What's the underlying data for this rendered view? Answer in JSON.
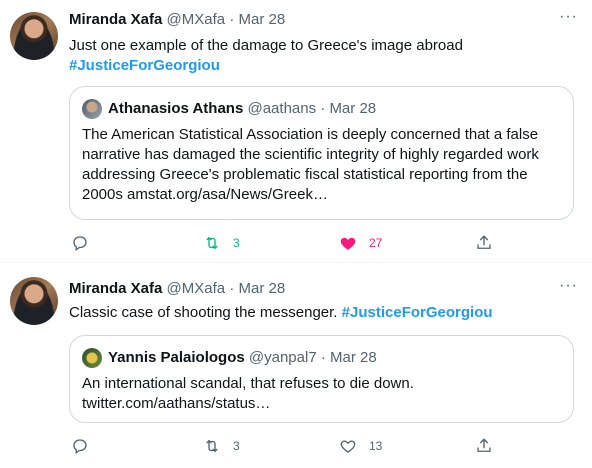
{
  "tweets": [
    {
      "author_name": "Miranda Xafa",
      "author_handle": "@MXafa",
      "sep": "·",
      "date": "Mar 28",
      "text_line1": "Just one example of the damage to Greece's image abroad",
      "hashtag": "#JusticeForGeorgiou",
      "quote": {
        "author_name": "Athanasios Athans",
        "author_handle": "@aathans",
        "date": "Mar 28",
        "lines": [
          "The American Statistical Association is deeply concerned that a false",
          "narrative has damaged the scientific integrity of highly regarded work",
          "addressing Greece's problematic fiscal statistical reporting from the",
          "2000s amstat.org/asa/News/Greek…"
        ]
      },
      "retweets": "3",
      "likes": "27",
      "retweeted": true,
      "liked": true
    },
    {
      "author_name": "Miranda Xafa",
      "author_handle": "@MXafa",
      "sep": "·",
      "date": "Mar 28",
      "text_line1": "Classic case of shooting the messenger.",
      "hashtag": "#JusticeForGeorgiou",
      "quote": {
        "author_name": "Yannis Palaiologos",
        "author_handle": "@yanpal7",
        "date": "Mar 28",
        "lines": [
          "An international scandal, that refuses to die down.",
          "twitter.com/aathans/status…"
        ]
      },
      "retweets": "3",
      "likes": "13",
      "retweeted": false,
      "liked": false
    }
  ],
  "icons": {
    "more": "more-icon",
    "reply": "reply-icon",
    "retweet": "retweet-icon",
    "like": "heart-icon",
    "share": "share-icon"
  },
  "colors": {
    "accent": "#1d9bf0",
    "retweet_active": "#00ba7c",
    "like_active": "#f91880",
    "muted": "#536471"
  }
}
